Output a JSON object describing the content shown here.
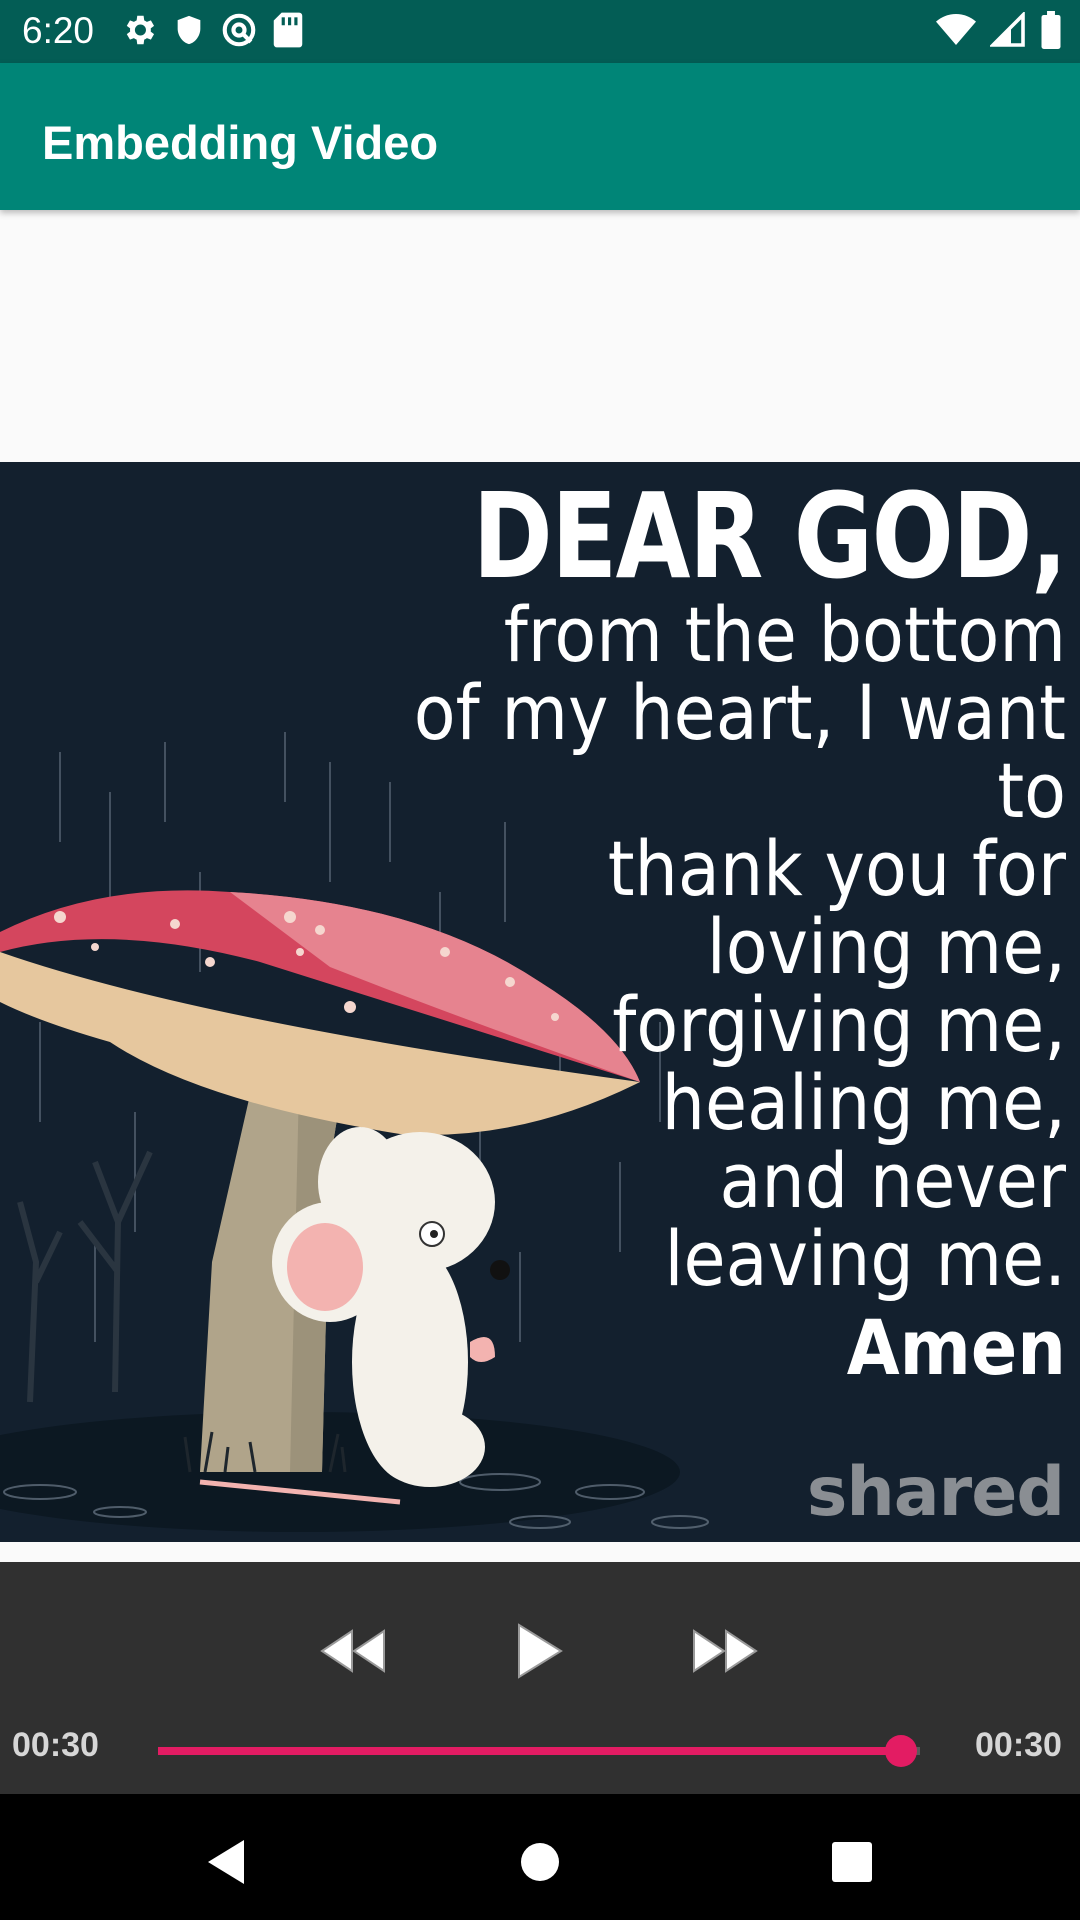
{
  "status_bar": {
    "time": "6:20",
    "left_icons": [
      "gear-icon",
      "shield-icon",
      "vpn-key-icon",
      "sd-card-icon"
    ],
    "right_icons": [
      "wifi-icon",
      "signal-icon",
      "battery-icon"
    ]
  },
  "app_bar": {
    "title": "Embedding Video"
  },
  "video": {
    "caption": {
      "heading": "DEAR GOD,",
      "lines": [
        "from the bottom",
        "of my heart, I want to",
        "thank you for",
        "loving me,",
        "forgiving me,",
        "healing me,",
        "and never",
        "leaving me."
      ],
      "closing": "Amen"
    },
    "watermark": "shared"
  },
  "controller": {
    "buttons": [
      "rewind-icon",
      "play-icon",
      "fast-forward-icon"
    ],
    "current_time": "00:30",
    "total_time": "00:30",
    "progress": 0.975,
    "accent_color": "#e31c63"
  },
  "nav_bar": {
    "buttons": [
      "back-icon",
      "home-icon",
      "recents-icon"
    ]
  }
}
